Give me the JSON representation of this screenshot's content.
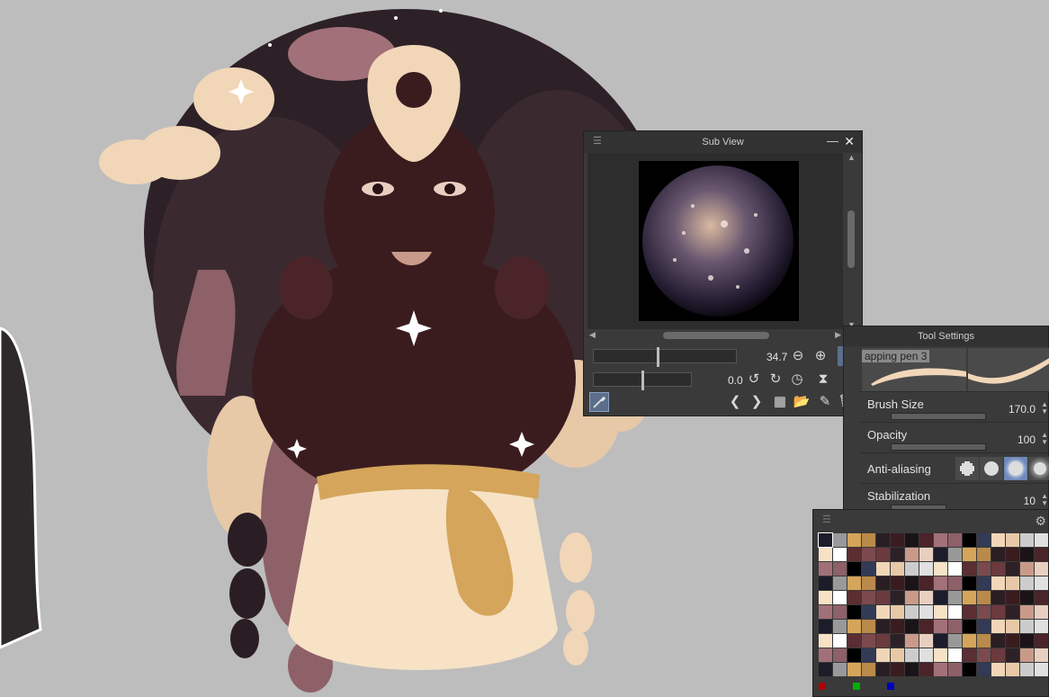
{
  "subview": {
    "title": "Sub View",
    "zoom_value": "34.7",
    "rotate_value": "0.0",
    "zoom_slider_level": 0.45,
    "rotate_slider_level": 0.5
  },
  "tool_settings": {
    "title": "Tool Settings",
    "brush_name": "apping pen 3",
    "rows": [
      {
        "label": "Brush Size",
        "value": "170.0"
      },
      {
        "label": "Opacity",
        "value": "100"
      },
      {
        "label": "Anti-aliasing",
        "value": ""
      },
      {
        "label": "Stabilization",
        "value": "10"
      }
    ],
    "antialias_selected": 2
  },
  "colors": {
    "accent": "#6e89b8",
    "canvas_bg": "#bdbdbd",
    "panel_bg": "#3a3a3a"
  },
  "icons": [
    "menu-icon",
    "minimize-icon",
    "close-icon",
    "zoom-out-icon",
    "zoom-in-icon",
    "fit-view-icon",
    "rotate-left-icon",
    "rotate-right-icon",
    "reset-rotation-icon",
    "flip-horizontal-icon",
    "flip-vertical-icon",
    "eyedropper-icon",
    "prev-icon",
    "next-icon",
    "grid-icon",
    "open-folder-icon",
    "edit-icon",
    "trash-icon",
    "settings-icon"
  ]
}
